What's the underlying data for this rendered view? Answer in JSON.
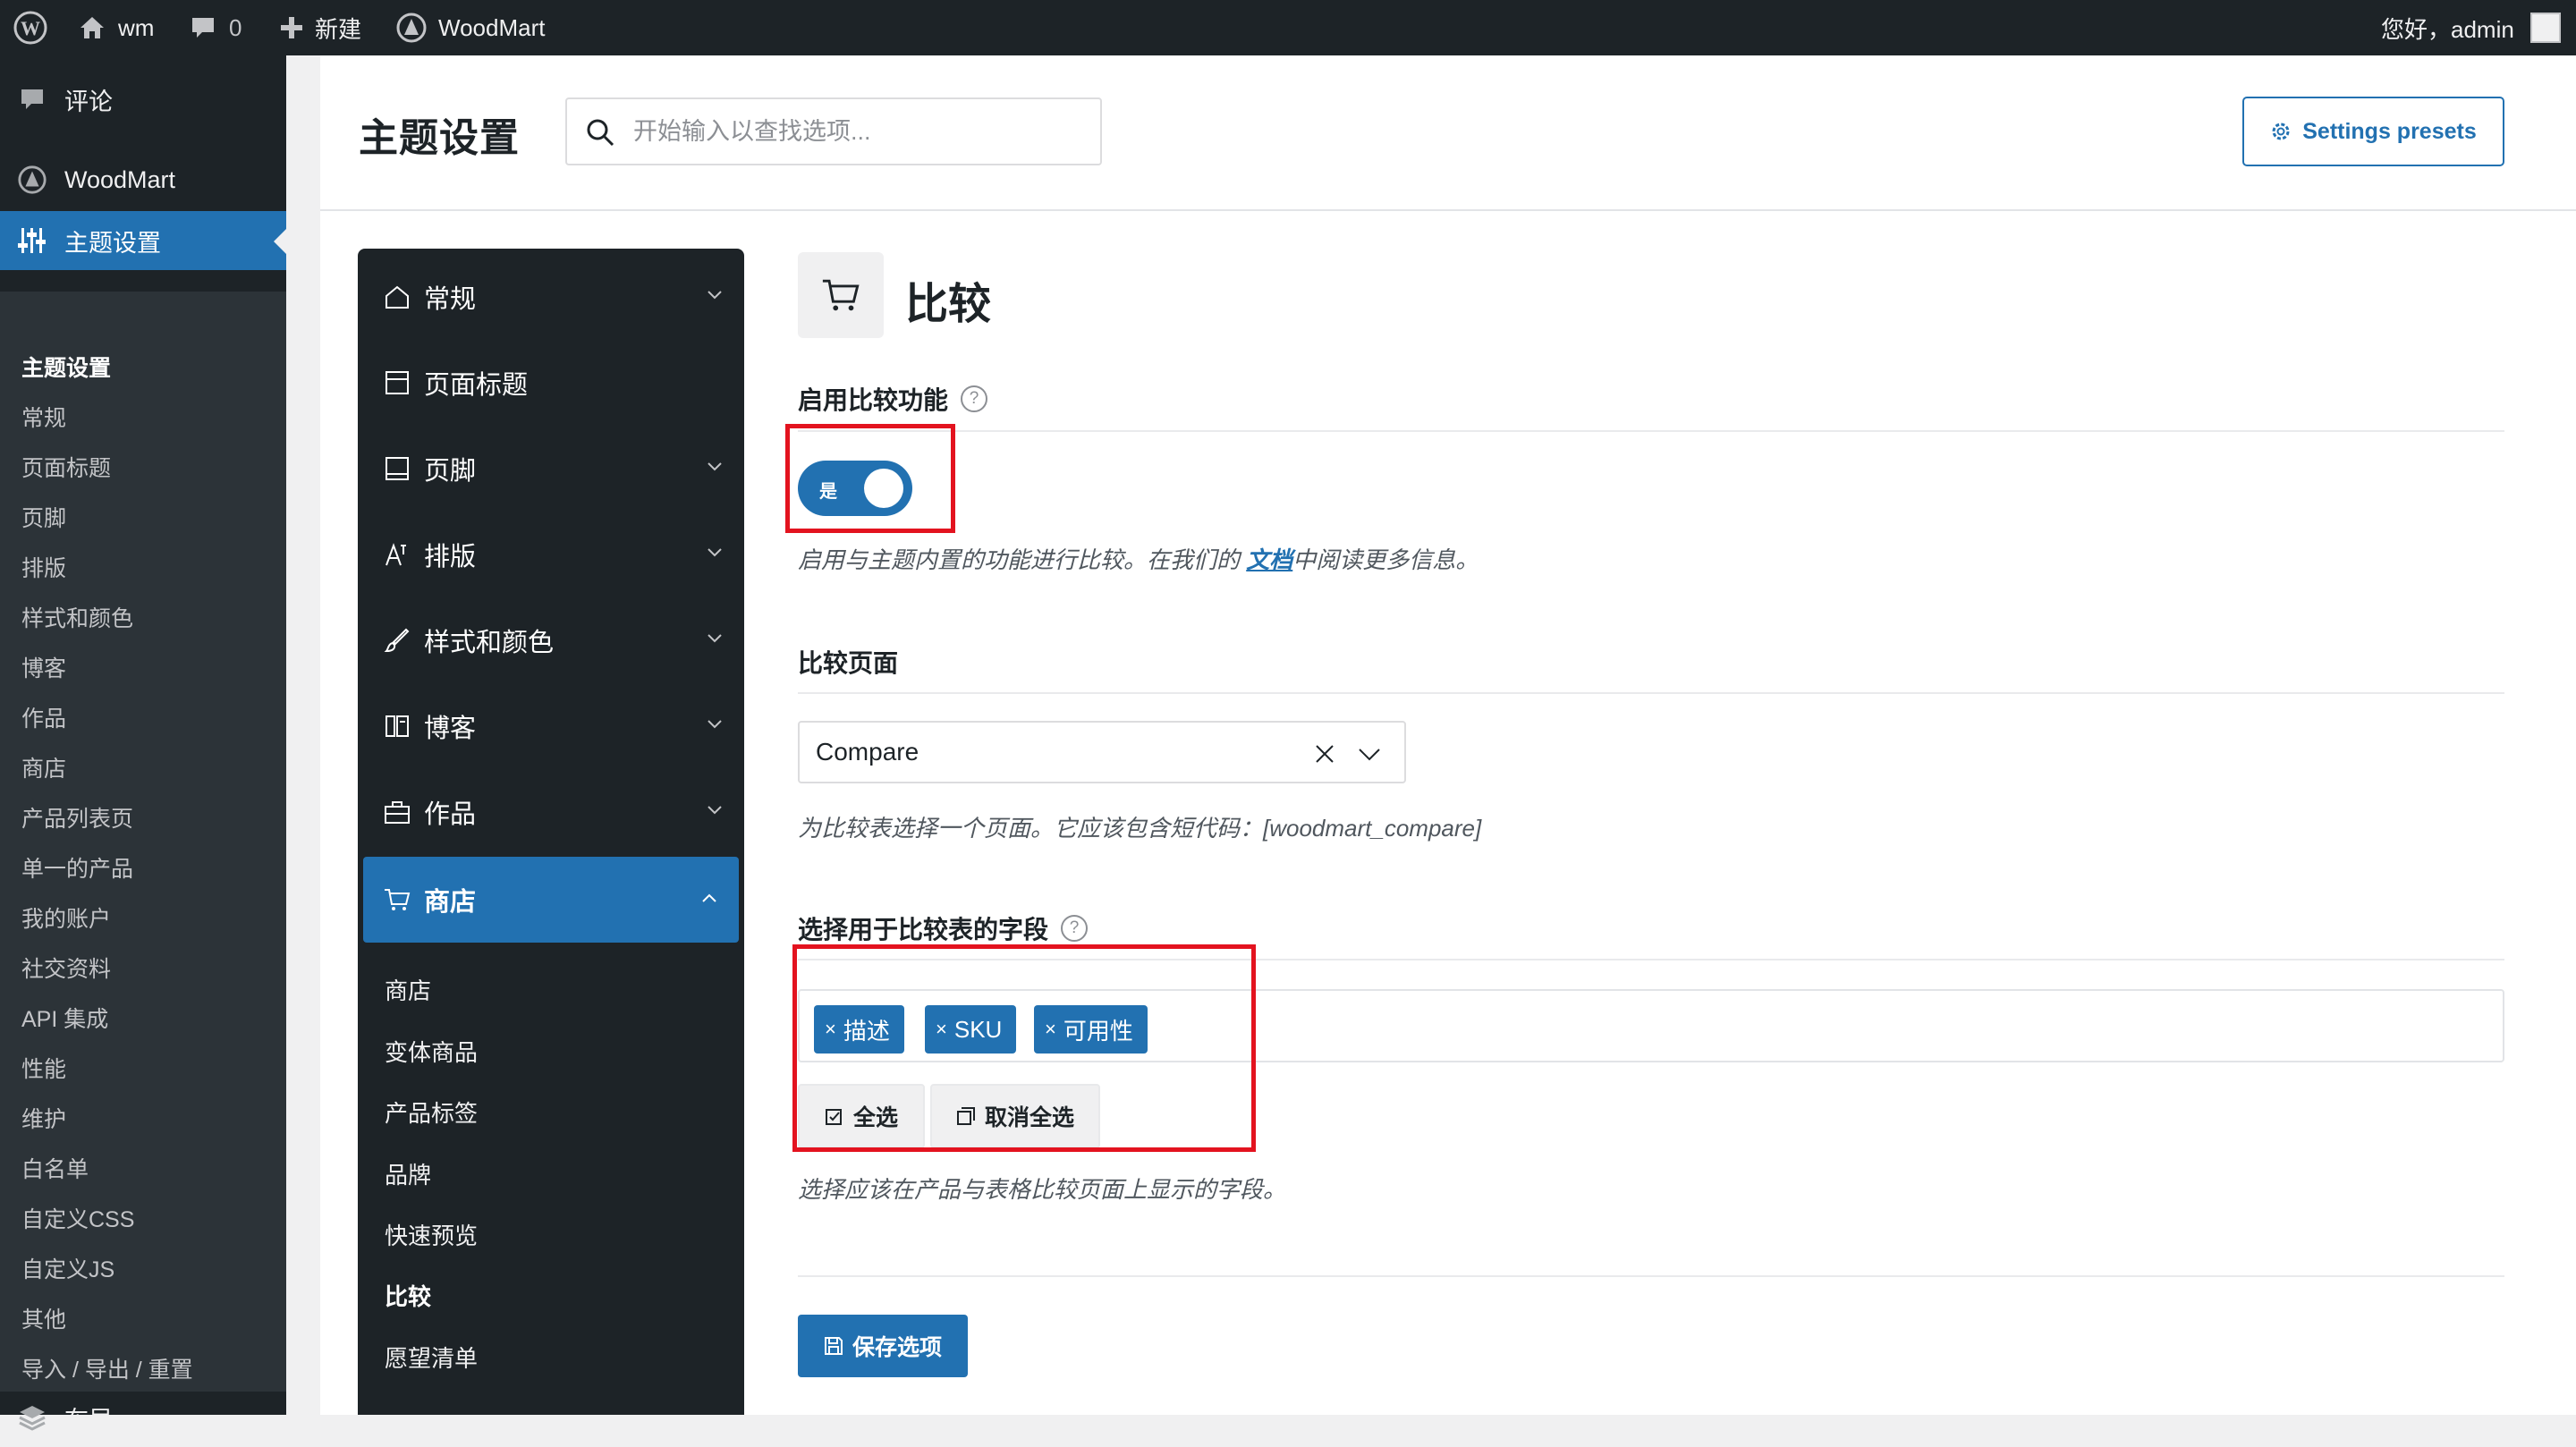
{
  "admin_bar": {
    "site_name": "wm",
    "comment_count": "0",
    "new_label": "新建",
    "plugin_label": "WoodMart",
    "greeting": "您好，admin"
  },
  "admin_menu": {
    "top_items": [
      {
        "label": "评论",
        "icon": "comment-icon"
      },
      {
        "label": "WoodMart",
        "icon": "woodmart-logo-icon"
      },
      {
        "label": "主题设置",
        "icon": "sliders-icon",
        "active": true
      }
    ],
    "submenu": [
      "主题设置",
      "常规",
      "页面标题",
      "页脚",
      "排版",
      "样式和颜色",
      "博客",
      "作品",
      "商店",
      "产品列表页",
      "单一的产品",
      "我的账户",
      "社交资料",
      "API 集成",
      "性能",
      "维护",
      "白名单",
      "自定义CSS",
      "自定义JS",
      "其他",
      "导入 / 导出 / 重置"
    ],
    "bottom_item": {
      "label": "布局",
      "icon": "layers-icon"
    }
  },
  "header": {
    "title": "主题设置",
    "search_placeholder": "开始输入以查找选项...",
    "presets_button": "Settings presets"
  },
  "settings_nav": {
    "items": [
      {
        "label": "常规",
        "icon": "home-icon",
        "chevron": true
      },
      {
        "label": "页面标题",
        "icon": "page-title-icon",
        "chevron": false
      },
      {
        "label": "页脚",
        "icon": "footer-icon",
        "chevron": true
      },
      {
        "label": "排版",
        "icon": "typography-icon",
        "chevron": true
      },
      {
        "label": "样式和颜色",
        "icon": "brush-icon",
        "chevron": true
      },
      {
        "label": "博客",
        "icon": "blog-icon",
        "chevron": true
      },
      {
        "label": "作品",
        "icon": "briefcase-icon",
        "chevron": true
      },
      {
        "label": "商店",
        "icon": "cart-icon",
        "chevron": true,
        "open": true
      }
    ],
    "shop_subitems": [
      "商店",
      "变体商品",
      "产品标签",
      "品牌",
      "快速预览",
      "比较",
      "愿望清单"
    ],
    "current_subitem": "比较"
  },
  "section": {
    "title": "比较",
    "icon": "cart-icon",
    "enable": {
      "title": "启用比较功能",
      "toggle_label": "是",
      "toggle_on": true,
      "desc_before": "启用与主题内置的功能进行比较。在我们的 ",
      "desc_link": "文档",
      "desc_after": "中阅读更多信息。"
    },
    "page": {
      "title": "比较页面",
      "selected": "Compare",
      "desc": "为比较表选择一个页面。它应该包含短代码：[woodmart_compare]"
    },
    "fields": {
      "title": "选择用于比较表的字段",
      "tags": [
        "描述",
        "SKU",
        "可用性"
      ],
      "select_all": "全选",
      "deselect_all": "取消全选",
      "desc": "选择应该在产品与表格比较页面上显示的字段。"
    },
    "save_button": "保存选项"
  },
  "colors": {
    "accent": "#2271b1",
    "admin_dark": "#1d2327",
    "highlight_box": "#e3131f"
  }
}
